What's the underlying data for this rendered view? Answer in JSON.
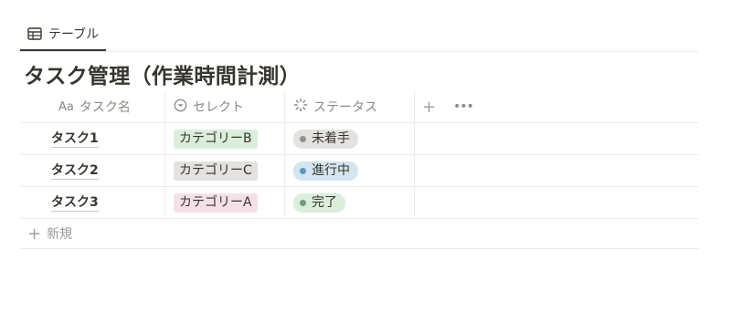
{
  "view_tabs": [
    {
      "label": "テーブル",
      "icon": "table-icon"
    }
  ],
  "title": "タスク管理（作業時間計測）",
  "columns": [
    {
      "label": "タスク名",
      "icon": "text-property-icon",
      "icon_text": "Aa"
    },
    {
      "label": "セレクト",
      "icon": "select-property-icon"
    },
    {
      "label": "ステータス",
      "icon": "status-property-icon"
    }
  ],
  "header_actions": {
    "add": "+",
    "more": "•••"
  },
  "rows": [
    {
      "name": "タスク1",
      "select": {
        "label": "カテゴリーB",
        "bg": "#dbeddb"
      },
      "status": {
        "label": "未着手",
        "bg": "#e3e2e0",
        "dot": "#91918e"
      }
    },
    {
      "name": "タスク2",
      "select": {
        "label": "カテゴリーC",
        "bg": "#e3e2e0"
      },
      "status": {
        "label": "進行中",
        "bg": "#d3e5ef",
        "dot": "#5b97bd"
      }
    },
    {
      "name": "タスク3",
      "select": {
        "label": "カテゴリーA",
        "bg": "#f5e0e9"
      },
      "status": {
        "label": "完了",
        "bg": "#dbeddb",
        "dot": "#6c9b7d"
      }
    }
  ],
  "new_row": {
    "label": "新規",
    "icon": "+"
  }
}
